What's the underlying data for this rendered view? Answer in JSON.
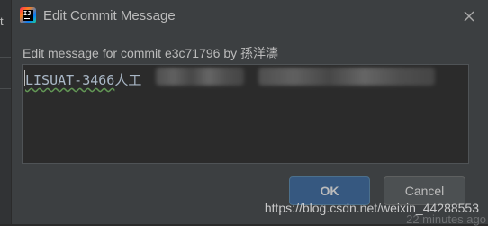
{
  "background": {
    "left_hint": "t",
    "bottom_hint": "22 minutes ago"
  },
  "dialog": {
    "title": "Edit Commit Message",
    "app_icon_label": "IJ",
    "prompt": "Edit message for commit e3c71796 by 孫洋濤",
    "message": {
      "code": "LISUAT-3466",
      "rest": "人工"
    },
    "ok_label": "OK",
    "cancel_label": "Cancel"
  },
  "watermark": "https://blog.csdn.net/weixin_44288553",
  "colors": {
    "dialog_bg": "#3c3f41",
    "editor_bg": "#2b2b2b",
    "ok_bg": "#365880",
    "cancel_bg": "#4c5052",
    "text": "#bbbbbb"
  }
}
